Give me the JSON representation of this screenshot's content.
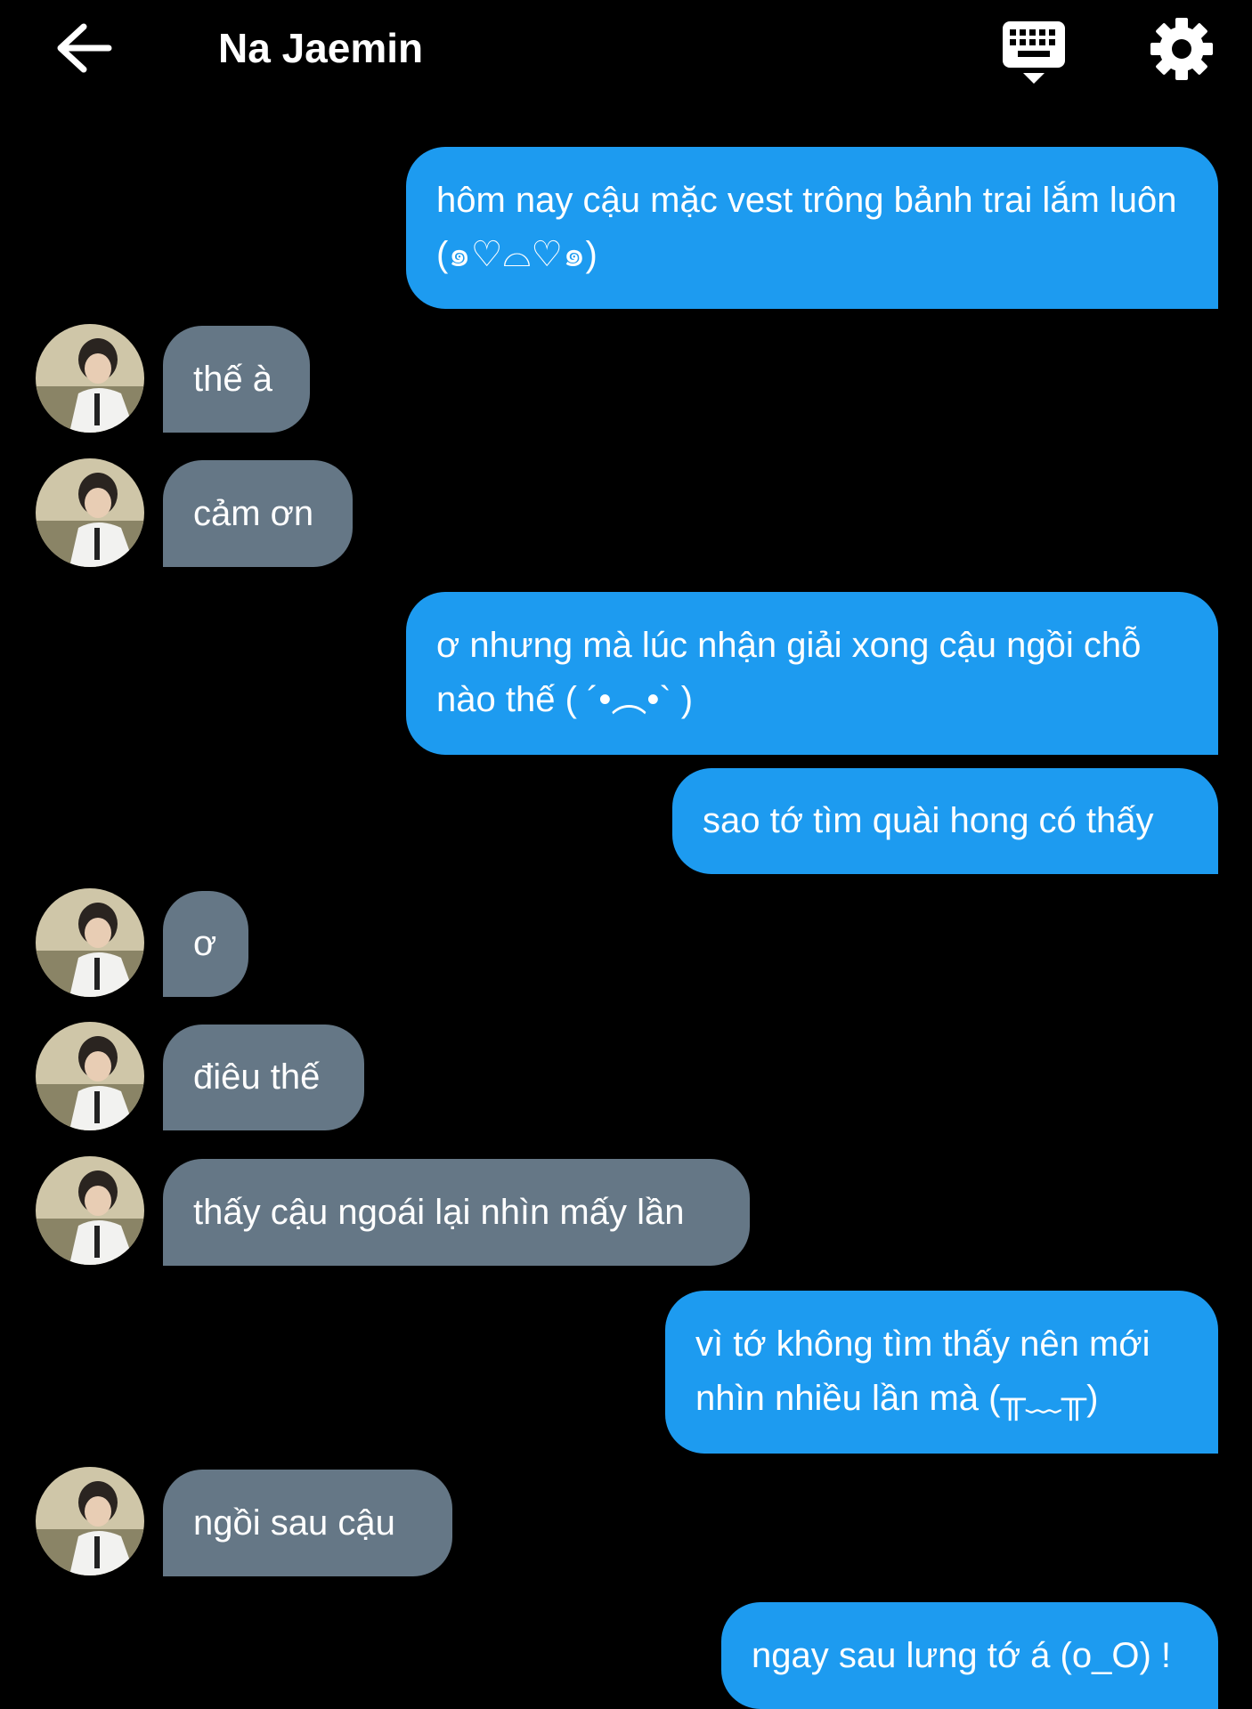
{
  "header": {
    "title": "Na Jaemin",
    "back_icon": "arrow-left-icon",
    "keyboard_icon": "keyboard-hide-icon",
    "settings_icon": "gear-icon"
  },
  "colors": {
    "background": "#000000",
    "sent_bubble": "#1d9bf0",
    "received_bubble": "#657786",
    "text": "#ffffff"
  },
  "messages": [
    {
      "side": "sent",
      "text": "hôm nay cậu mặc vest trông bảnh trai lắm luôn (๑♡⌓♡๑)"
    },
    {
      "side": "received",
      "text": "thế à"
    },
    {
      "side": "received",
      "text": "cảm ơn"
    },
    {
      "side": "sent",
      "text": "ơ nhưng mà lúc nhận giải xong cậu ngồi chỗ nào thế ( ´•︵•` )"
    },
    {
      "side": "sent",
      "text": "sao tớ tìm quài hong có thấy"
    },
    {
      "side": "received",
      "text": "ơ"
    },
    {
      "side": "received",
      "text": "điêu thế"
    },
    {
      "side": "received",
      "text": "thấy cậu ngoái lại nhìn mấy lần"
    },
    {
      "side": "sent",
      "text": "vì tớ không tìm thấy nên mới nhìn nhiều lần mà (╥﹏╥)"
    },
    {
      "side": "received",
      "text": "ngồi sau cậu"
    },
    {
      "side": "sent",
      "text": "ngay sau lưng tớ á (o_O) !"
    }
  ]
}
